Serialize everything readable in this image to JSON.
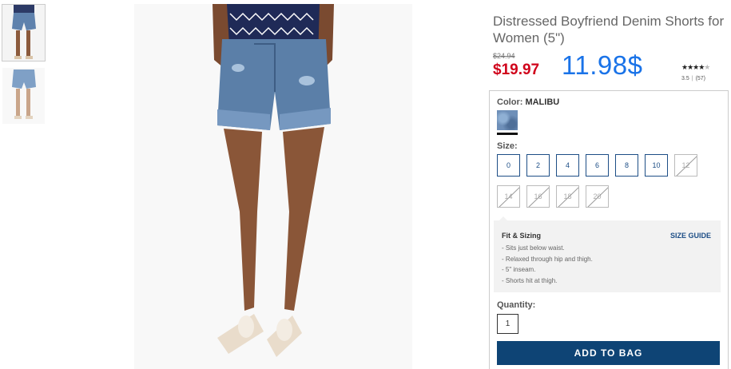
{
  "product": {
    "title": "Distressed Boyfriend Denim Shorts for Women (5\")",
    "old_price": "$24.94",
    "sale_price": "$19.97",
    "overlay_price": "11.98$",
    "rating": {
      "stars_filled": "★★★★",
      "stars_empty": "★",
      "value": "3.5",
      "count": "(57)",
      "separator": "|"
    }
  },
  "color": {
    "label": "Color:",
    "value": "MALIBU",
    "swatch_color": "#6e8fb8"
  },
  "size": {
    "label": "Size:",
    "options": [
      {
        "label": "0",
        "available": true
      },
      {
        "label": "2",
        "available": true
      },
      {
        "label": "4",
        "available": true
      },
      {
        "label": "6",
        "available": true
      },
      {
        "label": "8",
        "available": true
      },
      {
        "label": "10",
        "available": true
      },
      {
        "label": "12",
        "available": false
      },
      {
        "label": "14",
        "available": false
      },
      {
        "label": "16",
        "available": false
      },
      {
        "label": "18",
        "available": false
      },
      {
        "label": "20",
        "available": false
      }
    ]
  },
  "fit": {
    "title": "Fit & Sizing",
    "size_guide": "SIZE GUIDE",
    "bullets": [
      "- Sits just below waist.",
      "- Relaxed through hip and thigh.",
      "- 5\" inseam.",
      "- Shorts hit at thigh."
    ]
  },
  "quantity": {
    "label": "Quantity:",
    "value": "1"
  },
  "actions": {
    "add_to_bag": "ADD TO BAG"
  },
  "colors": {
    "accent": "#1d4e86",
    "button": "#0e4475",
    "sale": "#d0021b",
    "overlay": "#1a73e8"
  }
}
